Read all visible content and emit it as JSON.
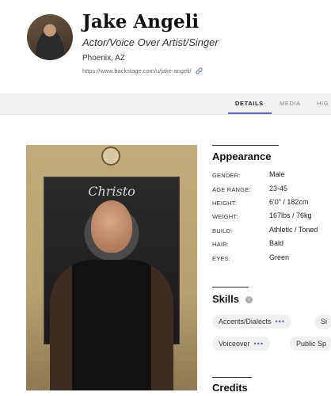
{
  "profile": {
    "name": "Jake Angeli",
    "roles": "Actor/Voice Over Artist/Singer",
    "location": "Phoenix, AZ",
    "url": "https://www.backstage.com/u/jake-angeli/"
  },
  "tabs": [
    "DETAILS",
    "MEDIA",
    "HIG"
  ],
  "appearance": {
    "title": "Appearance",
    "items": [
      {
        "label": "GENDER:",
        "value": "Male"
      },
      {
        "label": "AGE RANGE:",
        "value": "23-45"
      },
      {
        "label": "HEIGHT:",
        "value": "6'0\" / 182cm"
      },
      {
        "label": "WEIGHT:",
        "value": "167lbs / 76kg"
      },
      {
        "label": "BUILD:",
        "value": "Athletic / Toned"
      },
      {
        "label": "HAIR:",
        "value": "Bald"
      },
      {
        "label": "EYES:",
        "value": "Green"
      }
    ]
  },
  "skills": {
    "title": "Skills",
    "info": "i",
    "items": [
      "Accents/Dialects",
      "Si",
      "Voiceover",
      "Public Sp"
    ],
    "dots": "•••"
  },
  "credits": {
    "title": "Credits"
  },
  "photo": {
    "poster_text": "Christo"
  }
}
